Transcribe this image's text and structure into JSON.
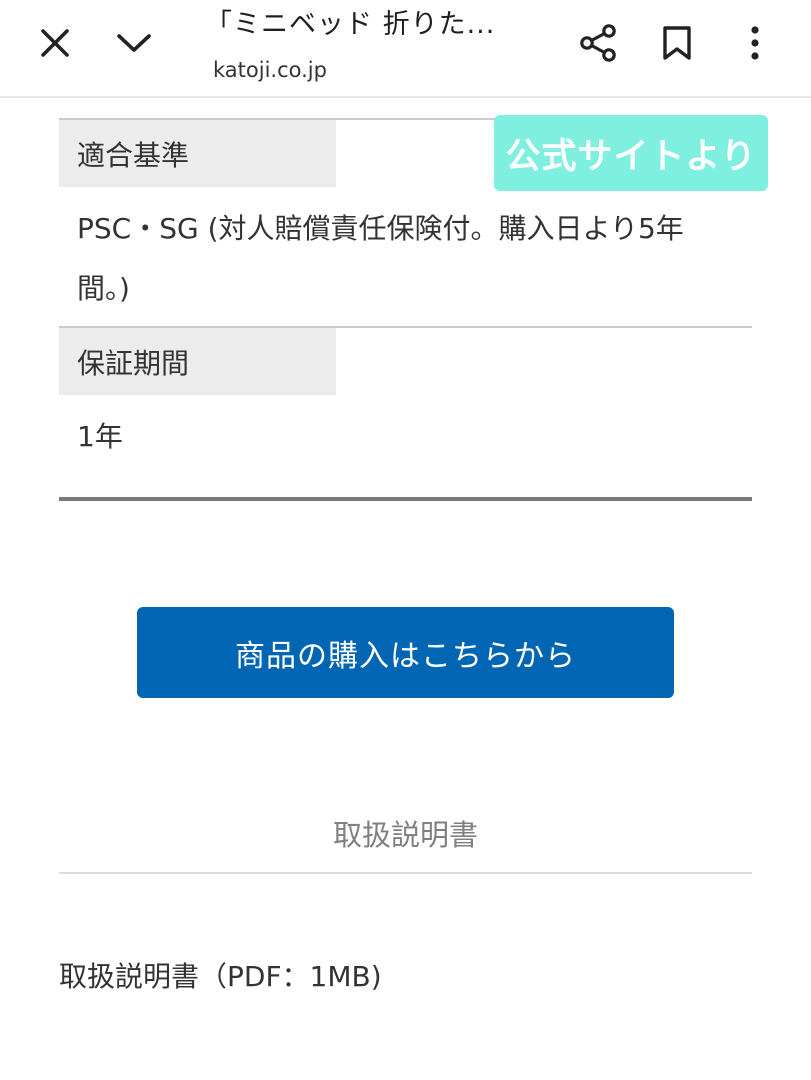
{
  "topbar": {
    "title": "「ミニベッド 折りた...",
    "url": "katoji.co.jp",
    "icons": {
      "close": "close-icon",
      "collapse": "chevron-down-icon",
      "share": "share-icon",
      "bookmark": "bookmark-icon",
      "menu": "more-vert-icon"
    }
  },
  "badge": {
    "text": "公式サイトより",
    "color": "#7ff0e0"
  },
  "specs": [
    {
      "label": "適合基準",
      "value": "PSC・SG (対人賠償責任保険付。購入日より5年間。)"
    },
    {
      "label": "保証期間",
      "value": "1年"
    }
  ],
  "buy_button": {
    "label": "商品の購入はこちらから",
    "color": "#0066b3"
  },
  "manual": {
    "heading": "取扱説明書",
    "link": "取扱説明書（PDF：1MB)"
  }
}
